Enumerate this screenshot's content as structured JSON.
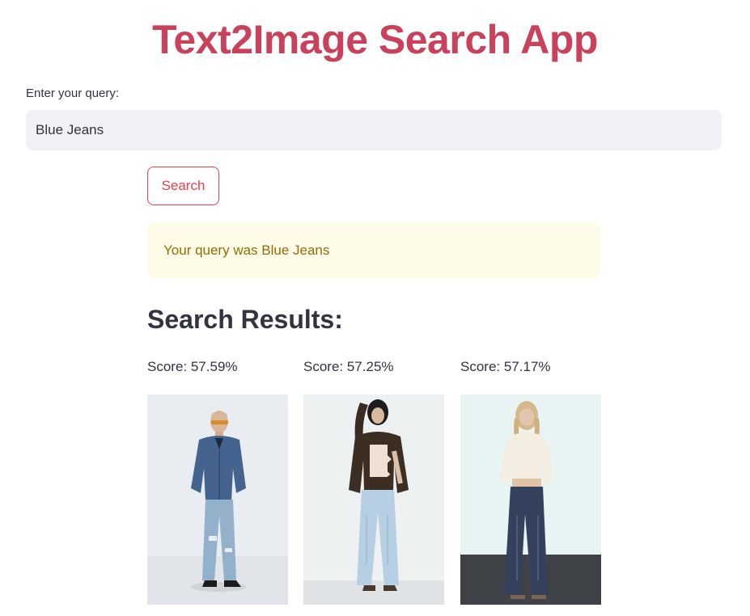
{
  "app": {
    "title": "Text2Image Search App"
  },
  "query": {
    "label": "Enter your query:",
    "value": "Blue Jeans"
  },
  "search_button": {
    "label": "Search"
  },
  "alert": {
    "text": "Your query was Blue Jeans"
  },
  "results": {
    "heading": "Search Results:",
    "items": [
      {
        "score": "Score: 57.59%",
        "image_alt": "man in denim jacket and ripped blue jeans"
      },
      {
        "score": "Score: 57.25%",
        "image_alt": "person in patchwork cardigan and light blue jeans"
      },
      {
        "score": "Score: 57.17%",
        "image_alt": "woman in white blouse and dark blue jeans"
      }
    ]
  },
  "colors": {
    "title": "#c9415b",
    "button_accent": "#e8414c",
    "alert_bg": "#fefce8",
    "alert_text": "#926c05",
    "input_bg": "#f0f2f6"
  }
}
